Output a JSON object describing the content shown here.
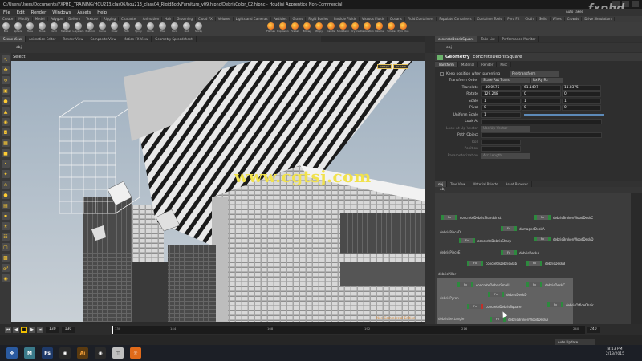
{
  "window": {
    "title": "C:/Users/Users/Documents/FXPHD_TRAINING/HOU213/clas06/hou213_class04_RigidBodyFurniture_v09.hipnc/DebrisColor_02.hipnc - Houdini Apprentice Non-Commercial",
    "brand": "fxphd",
    "auto_takes": "Auto Takes"
  },
  "menu": [
    "File",
    "Edit",
    "Render",
    "Windows",
    "Assets",
    "Help"
  ],
  "shelf_tabs": [
    "Create",
    "Modify",
    "Model",
    "Polygon",
    "Deform",
    "Texture",
    "Rigging",
    "Character",
    "Animation",
    "Hair",
    "Grooming",
    "Cloud FX",
    "Volume",
    "Lights and Cameras",
    "Particles",
    "Grains",
    "Rigid Bodies",
    "Particle Fluids",
    "Viscous Fluids",
    "Oceans",
    "Fluid Containers",
    "Populate Containers",
    "Container Tools",
    "Pyro FX",
    "Cloth",
    "Solid",
    "Wires",
    "Crowds",
    "Drive Simulation"
  ],
  "shelf_tools_left": [
    "Box",
    "Sphere",
    "Tube",
    "Torus",
    "Grid",
    "Metaball",
    "L-System",
    "Platonic",
    "Curve",
    "Draw",
    "Path",
    "Spray",
    "Circle",
    "File",
    "Font",
    "Null",
    "Sticky"
  ],
  "shelf_tools_right": [
    "Flames",
    "Explosion",
    "Fireball",
    "Billowy",
    "Wispy",
    "Candle",
    "Smolderin",
    "Dry Ice",
    "Detonation",
    "Volume",
    "Smoke",
    "Pyro Clus"
  ],
  "pane_tabs_left": [
    "Scene View",
    "Animation Editor",
    "Render View",
    "Composite View",
    "Motion FX View",
    "Geometry Spreadsheet"
  ],
  "pane_tabs_right": [
    "concreteDebrisSquare",
    "Take List",
    "Performance Monitor"
  ],
  "viewport": {
    "mode": "Select",
    "path": "obj",
    "badge_persp": "persp1",
    "badge_cam": "no cam",
    "watermark": "www.cgtsj.com",
    "nc_label": "Non-Commercial Edition"
  },
  "params": {
    "node_type": "Geometry",
    "node_name": "concreteDebrisSquare",
    "tabs": [
      "Transform",
      "Material",
      "Render",
      "Misc"
    ],
    "keep_position_label": "Keep position when parenting",
    "keep_position_value": "Pre-transform",
    "transform_order_label": "Transform Order",
    "transform_order_value": "Scale Rot Trans",
    "rot_order_value": "Rx Ry Rz",
    "translate": {
      "label": "Translate",
      "x": "-40.0575",
      "y": "61.1497",
      "z": "11.8375"
    },
    "rotate": {
      "label": "Rotate",
      "x": "129.248",
      "y": "0",
      "z": "0"
    },
    "scale": {
      "label": "Scale",
      "x": "1",
      "y": "1",
      "z": "1"
    },
    "pivot": {
      "label": "Pivot",
      "x": "0",
      "y": "0",
      "z": "0"
    },
    "uniform_scale": {
      "label": "Uniform Scale",
      "value": "1"
    },
    "look_at": {
      "label": "Look At"
    },
    "look_up": {
      "label": "Look At Up Vector",
      "value": "Use Up Vector"
    },
    "path_object": {
      "label": "Path Object"
    },
    "roll": {
      "label": "Roll"
    },
    "position": {
      "label": "Position"
    },
    "param_label": {
      "label": "Parameterization",
      "value": "Arc Length"
    }
  },
  "network": {
    "tabs": [
      "obj",
      "Tree View",
      "Material Palette",
      "Asset Browser"
    ],
    "path": "obj",
    "nodes": [
      {
        "label": "concreteDebrisShardsInst",
        "red": false
      },
      {
        "label": "debrisBrokenWoodDeskC",
        "red": false
      },
      {
        "label": "damagedDeskA",
        "red": false
      },
      {
        "label": "concreteDebrisSharp",
        "red": false
      },
      {
        "label": "debrisBrokenWoodDeskD",
        "red": false
      },
      {
        "label": "debrisDeskA",
        "red": false
      },
      {
        "label": "concreteDebrisSlab",
        "red": false
      },
      {
        "label": "debrisDeskB",
        "red": false
      },
      {
        "label": "concreteDebrisSmall",
        "red": false
      },
      {
        "label": "debrisDeskC",
        "red": false
      },
      {
        "label": "debrisDeskD",
        "red": false
      },
      {
        "label": "debrisOfficeChair",
        "red": false
      },
      {
        "label": "concreteDebrisSquare",
        "red": true
      },
      {
        "label": "debrisBrokenWoodDeskA",
        "red": false
      }
    ],
    "side_labels": [
      "debrisPieceD",
      "debrisPieceE",
      "debrisPillar",
      "debrisPyron",
      "debrisRectangle"
    ]
  },
  "timeline": {
    "start": "130",
    "current": "130",
    "end": "240",
    "field_end": "240",
    "ticks": [
      "130",
      "144",
      "168",
      "192",
      "216",
      "240"
    ],
    "auto_update": "Auto Update"
  },
  "taskbar": {
    "time": "8:13 PM",
    "date": "2/13/2015"
  }
}
